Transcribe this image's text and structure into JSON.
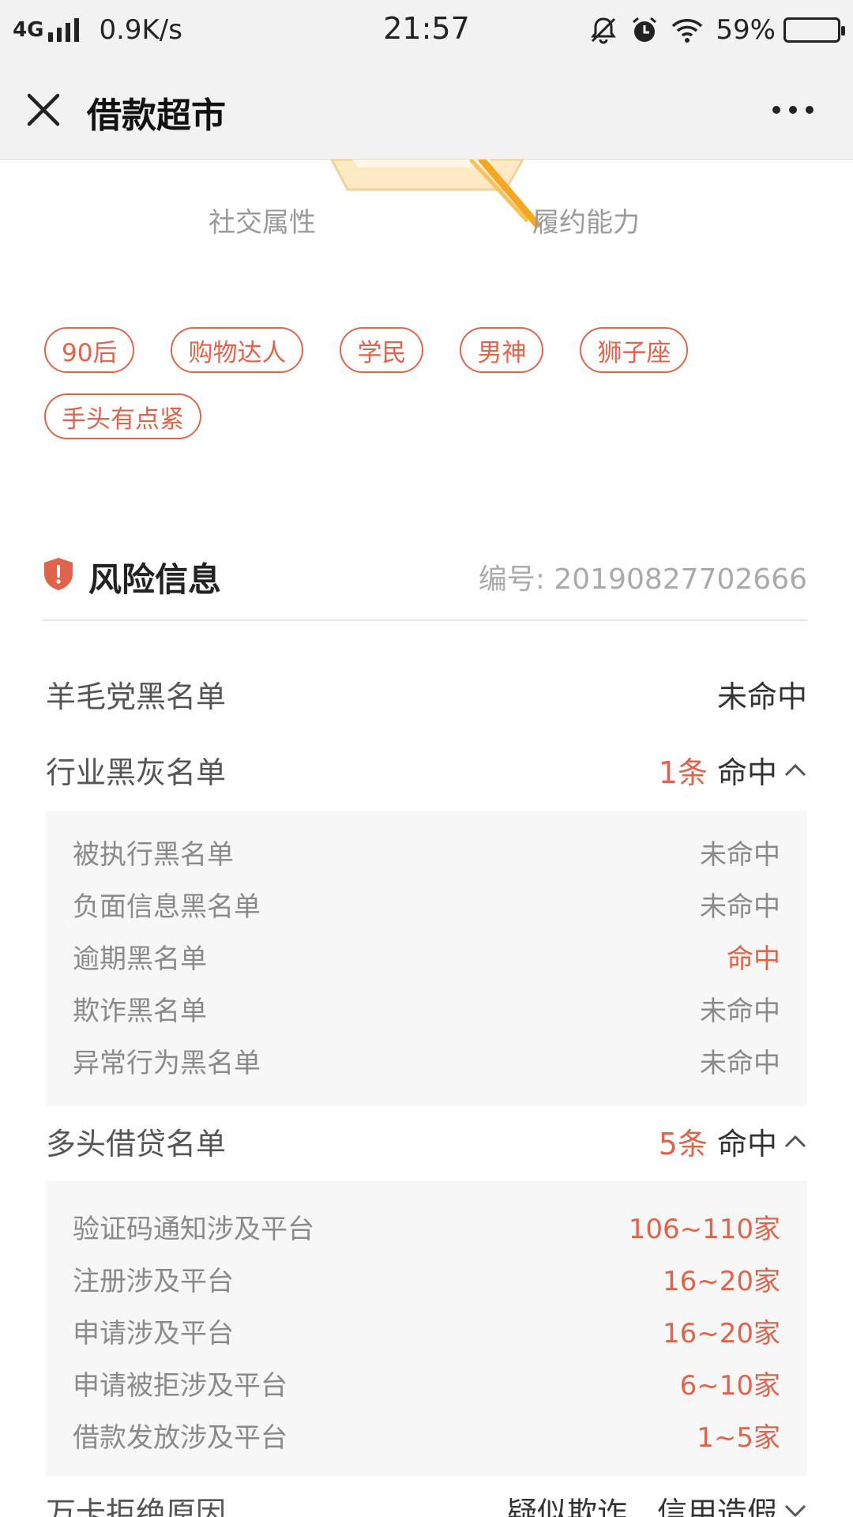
{
  "status_bar": {
    "network": "4G",
    "speed": "0.9K/s",
    "time": "21:57",
    "battery": "59%",
    "battery_level": 0.59
  },
  "nav": {
    "title": "借款超市"
  },
  "radar": {
    "label_left": "社交属性",
    "label_right": "履约能力"
  },
  "tags": [
    "90后",
    "购物达人",
    "学民",
    "男神",
    "狮子座",
    "手头有点紧"
  ],
  "risk": {
    "title": "风险信息",
    "serial": "编号: 20190827702666",
    "rows": {
      "wool": {
        "label": "羊毛党黑名单",
        "value": "未命中"
      },
      "industry": {
        "label": "行业黑灰名单",
        "count": "1条",
        "value": "命中"
      },
      "multi": {
        "label": "多头借贷名单",
        "count": "5条",
        "value": "命中"
      },
      "wanka": {
        "label": "万卡拒绝原因",
        "value": "疑似欺诈、信用造假"
      }
    },
    "industry_items": [
      {
        "label": "被执行黑名单",
        "value": "未命中",
        "hit": false
      },
      {
        "label": "负面信息黑名单",
        "value": "未命中",
        "hit": false
      },
      {
        "label": "逾期黑名单",
        "value": "命中",
        "hit": true
      },
      {
        "label": "欺诈黑名单",
        "value": "未命中",
        "hit": false
      },
      {
        "label": "异常行为黑名单",
        "value": "未命中",
        "hit": false
      }
    ],
    "multi_items": [
      {
        "label": "验证码通知涉及平台",
        "value": "106~110家"
      },
      {
        "label": "注册涉及平台",
        "value": "16~20家"
      },
      {
        "label": "申请涉及平台",
        "value": "16~20家"
      },
      {
        "label": "申请被拒涉及平台",
        "value": "6~10家"
      },
      {
        "label": "借款发放涉及平台",
        "value": "1~5家"
      }
    ]
  },
  "colors": {
    "accent": "#e0644b",
    "radar_orange": "#f5a623"
  }
}
